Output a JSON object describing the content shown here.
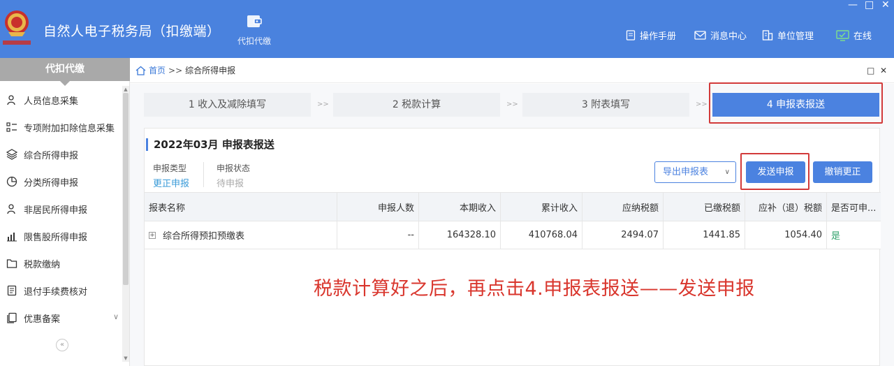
{
  "header": {
    "app_title": "自然人电子税务局（扣缴端）",
    "nav_tool_label": "代扣代缴",
    "links": [
      {
        "label": "操作手册",
        "icon": "document-icon"
      },
      {
        "label": "消息中心",
        "icon": "mail-icon"
      },
      {
        "label": "单位管理",
        "icon": "building-icon"
      },
      {
        "label": "在线",
        "icon": "monitor-icon"
      }
    ],
    "window_controls": {
      "minimize": "—",
      "maximize": "□",
      "close": "✕"
    },
    "brand_color": "#4a82de"
  },
  "sidebar": {
    "title": "代扣代缴",
    "items": [
      {
        "label": "人员信息采集",
        "icon": "person-icon"
      },
      {
        "label": "专项附加扣除信息采集",
        "icon": "list-icon"
      },
      {
        "label": "综合所得申报",
        "icon": "layers-icon"
      },
      {
        "label": "分类所得申报",
        "icon": "pie-chart-icon"
      },
      {
        "label": "非居民所得申报",
        "icon": "person-icon"
      },
      {
        "label": "限售股所得申报",
        "icon": "bar-chart-icon"
      },
      {
        "label": "税款缴纳",
        "icon": "folder-icon"
      },
      {
        "label": "退付手续费核对",
        "icon": "receipt-icon"
      },
      {
        "label": "优惠备案",
        "icon": "copy-icon"
      }
    ],
    "collapse_glyph": "«",
    "expand_glyph": "∨"
  },
  "breadcrumb": {
    "home": "首页",
    "separator": ">>",
    "current": "综合所得申报",
    "controls": {
      "restore": "□",
      "close": "✕"
    }
  },
  "steps": [
    {
      "label": "1 收入及减除填写",
      "active": false
    },
    {
      "label": "2 税款计算",
      "active": false
    },
    {
      "label": "3 附表填写",
      "active": false
    },
    {
      "label": "4 申报表报送",
      "active": true
    }
  ],
  "step_separator": ">>",
  "panel": {
    "title": "2022年03月  申报表报送",
    "declare_type_label": "申报类型",
    "declare_type_value": "更正申报",
    "declare_status_label": "申报状态",
    "declare_status_value": "待申报",
    "export_button": "导出申报表",
    "send_button": "发送申报",
    "revoke_button": "撤销更正"
  },
  "table": {
    "columns": [
      "报表名称",
      "申报人数",
      "本期收入",
      "累计收入",
      "应纳税额",
      "已缴税额",
      "应补（退）税额",
      "是否可申..."
    ],
    "rows": [
      {
        "expand_glyph": "+",
        "cells": [
          "综合所得预扣预缴表",
          "--",
          "164328.10",
          "410768.04",
          "2494.07",
          "1441.85",
          "1054.40",
          "是"
        ]
      }
    ]
  },
  "annotation": "税款计算好之后，再点击4.申报表报送——发送申报",
  "colors": {
    "accent": "#4b82e0",
    "highlight_box": "#d23a3a",
    "annotation_text": "#d9362d",
    "yes_green": "#2fa26b"
  }
}
